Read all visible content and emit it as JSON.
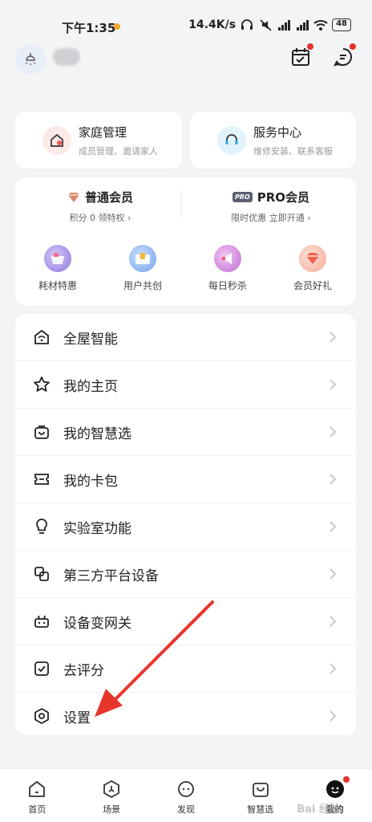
{
  "status": {
    "time": "下午1:35",
    "speed": "14.4K/s",
    "battery": "48"
  },
  "quick": [
    {
      "title": "家庭管理",
      "sub": "成员管理、邀请家人"
    },
    {
      "title": "服务中心",
      "sub": "维修安装、联系客服"
    }
  ],
  "membership": {
    "normal": {
      "title": "普通会员",
      "sub": "积分 0   领特权 ›"
    },
    "pro": {
      "badge": "PRO",
      "title": "PRO会员",
      "sub": "限时优惠 立即开通 ›"
    }
  },
  "perks": [
    "耗材特惠",
    "用户共创",
    "每日秒杀",
    "会员好礼"
  ],
  "menu": [
    "全屋智能",
    "我的主页",
    "我的智慧选",
    "我的卡包",
    "实验室功能",
    "第三方平台设备",
    "设备变网关",
    "去评分",
    "设置"
  ],
  "tabs": [
    "首页",
    "场景",
    "发现",
    "智慧选",
    "我的"
  ],
  "watermark": "Bai 经验",
  "colors": {
    "accent": "#e5322d",
    "bg": "#f3f4f6"
  }
}
